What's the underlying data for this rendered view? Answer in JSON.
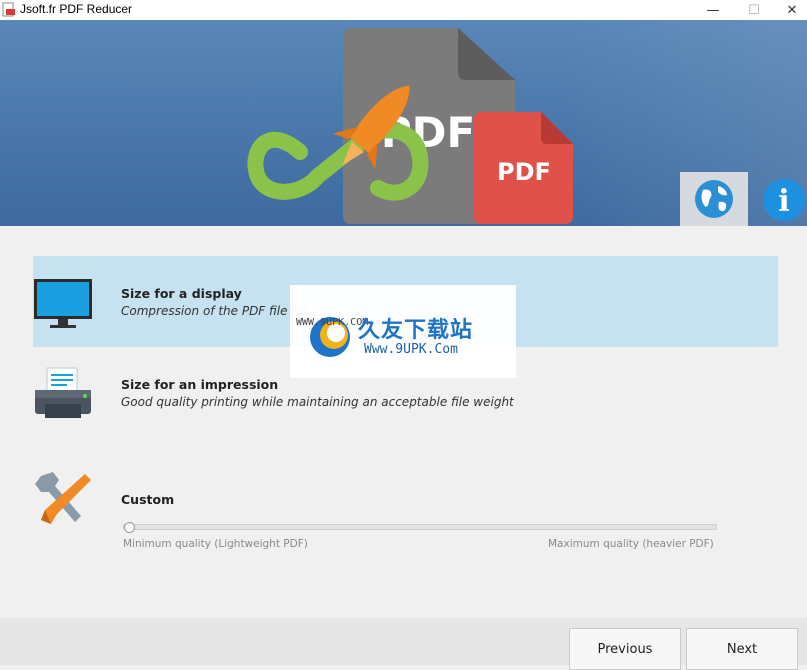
{
  "window": {
    "title": "Jsoft.fr PDF Reducer",
    "controls": {
      "minimize": "—",
      "maximize": "☐",
      "close": "✕"
    }
  },
  "hero": {
    "pdf_large_label": "PDF",
    "pdf_small_label": "PDF",
    "icons": {
      "logo": "infinity-rocket-logo",
      "language": "globe-icon",
      "about": "info-icon"
    },
    "info_glyph": "i"
  },
  "options": [
    {
      "title": "Size for a display",
      "description": "Compression of the PDF file for",
      "icon": "monitor-icon",
      "selected": true
    },
    {
      "title": "Size for an impression",
      "description": "Good quality printing while maintaining an acceptable file weight",
      "icon": "printer-icon",
      "selected": false
    },
    {
      "title": "Custom",
      "description": "",
      "icon": "tools-icon",
      "selected": false
    }
  ],
  "custom_slider": {
    "value": 0,
    "min_label": "Minimum quality (Lightweight PDF)",
    "max_label": "Maximum quality (heavier PDF)"
  },
  "footer": {
    "previous_label": "Previous",
    "next_label": "Next"
  },
  "watermark": {
    "small_text": "WWW.9UPK.COM",
    "big_text": "久友下载站",
    "url": "Www.9UPK.Com",
    "ghost": "efxz.com"
  },
  "colors": {
    "hero_blue": "#4a77aa",
    "selected_row": "#c6e1ef",
    "pdf_red": "#e0514a",
    "logo_green": "#8bc34a",
    "rocket_orange": "#f08a24"
  }
}
